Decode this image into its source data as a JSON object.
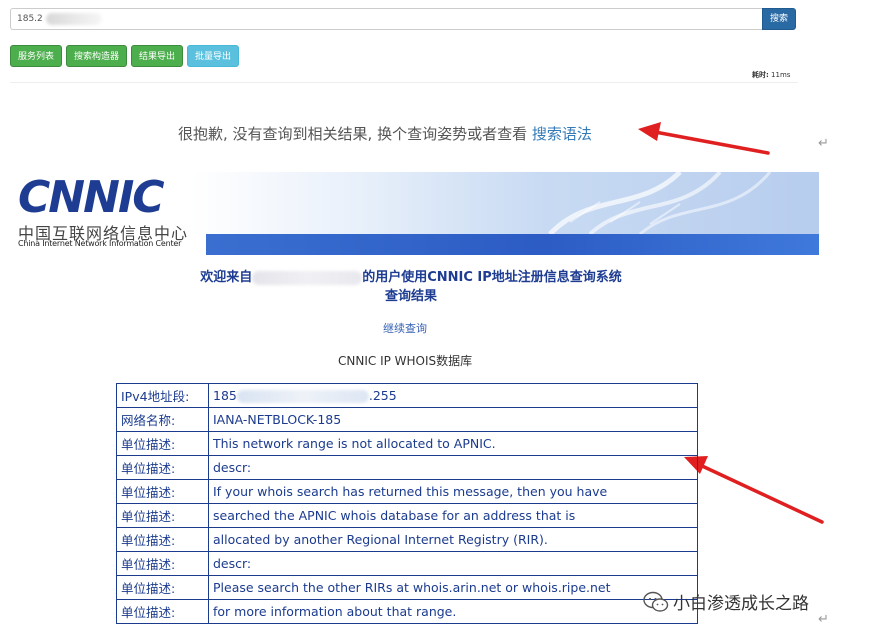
{
  "search": {
    "value": "185.2",
    "button_label": "搜索"
  },
  "toolbar": {
    "buttons": [
      {
        "label": "服务列表"
      },
      {
        "label": "搜索构造器"
      },
      {
        "label": "结果导出"
      },
      {
        "label": "批量导出"
      }
    ]
  },
  "stats": {
    "elapsed_label": "耗时:",
    "elapsed_value": "11ms"
  },
  "no_result": {
    "text": "很抱歉, 没有查询到相关结果, 换个查询姿势或者查看 ",
    "link": "搜索语法"
  },
  "return_mark": "↵",
  "banner": {
    "logo_text": "CNNIC",
    "logo_cn": "中国互联网络信息中心",
    "logo_en": "China Internet Network Information Center"
  },
  "welcome": {
    "prefix": "欢迎来自",
    "suffix": "的用户使用CNNIC IP地址注册信息查询系统",
    "line2": "查询结果"
  },
  "continue_link": "继续查询",
  "db_title": "CNNIC IP WHOIS数据库",
  "whois": {
    "rows": [
      {
        "key": "IPv4地址段:",
        "value_prefix": "185",
        "value_suffix": ".255"
      },
      {
        "key": "网络名称:",
        "value": "IANA-NETBLOCK-185"
      },
      {
        "key": "单位描述:",
        "value": "This network range is not allocated to APNIC."
      },
      {
        "key": "单位描述:",
        "value": "descr:"
      },
      {
        "key": "单位描述:",
        "value": "If your whois search has returned this message, then you have"
      },
      {
        "key": "单位描述:",
        "value": "searched the APNIC whois database for an address that is"
      },
      {
        "key": "单位描述:",
        "value": "allocated by another Regional Internet Registry (RIR)."
      },
      {
        "key": "单位描述:",
        "value": "descr:"
      },
      {
        "key": "单位描述:",
        "value": "Please search the other RIRs at whois.arin.net or whois.ripe.net"
      },
      {
        "key": "单位描述:",
        "value": "for more information about that range."
      }
    ]
  },
  "watermark": {
    "text": "小白渗透成长之路",
    "icon": "wechat-icon"
  },
  "colors": {
    "arrow": "#e02020",
    "table_border": "#1b3b8f",
    "heading": "#1e3d92",
    "link": "#337ab7"
  }
}
